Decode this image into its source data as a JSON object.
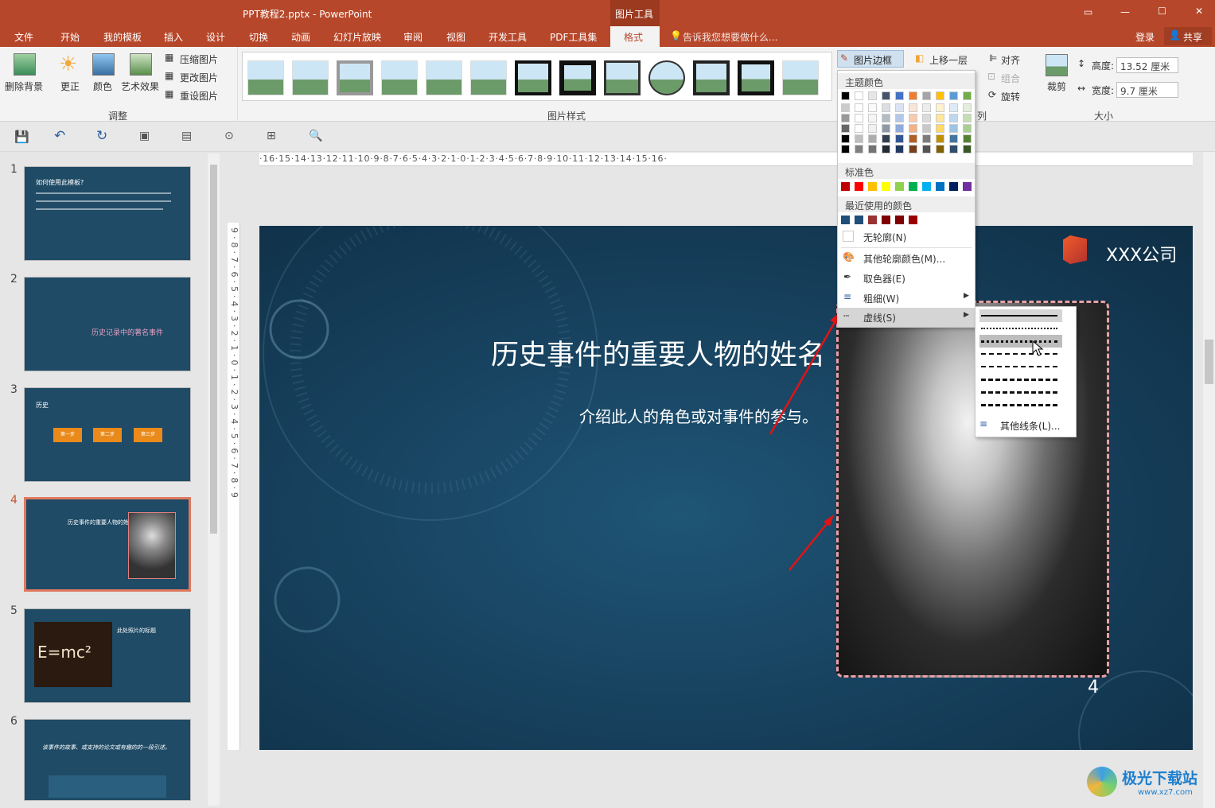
{
  "title_bar": {
    "doc_title": "PPT教程2.pptx - PowerPoint",
    "context_tab": "图片工具",
    "restore": "▭",
    "min": "—",
    "max": "☐",
    "close": "✕"
  },
  "tabs": [
    "文件",
    "开始",
    "我的模板",
    "插入",
    "设计",
    "切换",
    "动画",
    "幻灯片放映",
    "审阅",
    "视图",
    "开发工具",
    "PDF工具集",
    "格式"
  ],
  "tell_me": "告诉我您想要做什么...",
  "login": "登录",
  "share": "共享",
  "ribbon": {
    "remove_bg": "删除背景",
    "correct": "更正",
    "color": "颜色",
    "artistic": "艺术效果",
    "compress": "压缩图片",
    "change": "更改图片",
    "reset": "重设图片",
    "group_adjust": "调整",
    "group_styles": "图片样式",
    "border": "图片边框",
    "bring_forward": "上移一层",
    "align": "对齐",
    "group": "组合",
    "rotate": "旋转",
    "group_arrange": "列",
    "crop": "裁剪",
    "height_label": "高度:",
    "height_value": "13.52 厘米",
    "width_label": "宽度:",
    "width_value": "9.7 厘米",
    "group_size": "大小"
  },
  "ruler_top": "·16·15·14·13·12·11·10·9·8·7·6·5·4·3·2·1·0·1·2·3·4·5·6·7·8·9·10·11·12·13·14·15·16·",
  "ruler_left": "9·8·7·6·5·4·3·2·1·0·1·2·3·4·5·6·7·8·9",
  "thumbnails": [
    {
      "num": "1",
      "title": "如何使用此模板?",
      "selected": false
    },
    {
      "num": "2",
      "title": "历史记录中的著名事件",
      "selected": false
    },
    {
      "num": "3",
      "title": "历史",
      "selected": false,
      "steps": [
        "第一步",
        "第二步",
        "第三步"
      ]
    },
    {
      "num": "4",
      "title": "历史事件的重要人物的姓名",
      "selected": true
    },
    {
      "num": "5",
      "title": "此处照片的标题",
      "selected": false,
      "formula": "E=mc²"
    },
    {
      "num": "6",
      "title": "该事件的故事、或支持的论文或有趣的的一段引述。",
      "selected": false
    }
  ],
  "slide": {
    "title": "历史事件的重要人物的姓名",
    "subtitle": "介绍此人的角色或对事件的参与。",
    "company": "XXX公司",
    "page_num": "4"
  },
  "border_menu": {
    "theme_colors": "主题颜色",
    "standard_colors": "标准色",
    "recent_colors": "最近使用的颜色",
    "no_outline": "无轮廓(N)",
    "more_colors": "其他轮廓颜色(M)...",
    "eyedropper": "取色器(E)",
    "weight": "粗细(W)",
    "dashes": "虚线(S)"
  },
  "dash_menu": {
    "more_lines": "其他线条(L)..."
  },
  "colors": {
    "accent": "#b7472a",
    "theme_top": [
      "#000000",
      "#ffffff",
      "#e7e6e6",
      "#44546a",
      "#4472c4",
      "#ed7d31",
      "#a5a5a5",
      "#ffc000",
      "#5b9bd5",
      "#70ad47"
    ],
    "standard": [
      "#c00000",
      "#ff0000",
      "#ffc000",
      "#ffff00",
      "#92d050",
      "#00b050",
      "#00b0f0",
      "#0070c0",
      "#002060",
      "#7030a0"
    ],
    "recent": [
      "#1f4e79",
      "#1f4e79",
      "#993333",
      "#7f0000",
      "#7f0000",
      "#990000"
    ]
  },
  "watermark": "极光下载站",
  "watermark_url": "www.xz7.com"
}
